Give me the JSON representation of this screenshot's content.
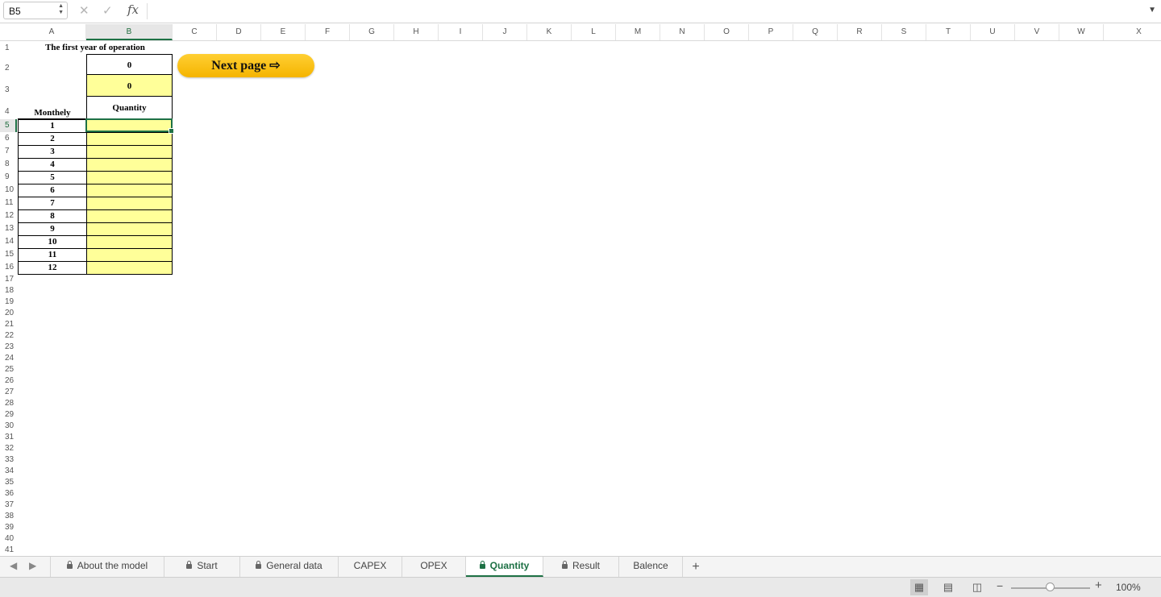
{
  "formula_bar": {
    "cell_ref": "B5",
    "cancel_glyph": "✕",
    "enter_glyph": "✓",
    "fx_label": "fx",
    "formula": ""
  },
  "columns": [
    "A",
    "B",
    "C",
    "D",
    "E",
    "F",
    "G",
    "H",
    "I",
    "J",
    "K",
    "L",
    "M",
    "N",
    "O",
    "P",
    "Q",
    "R",
    "S",
    "T",
    "U",
    "V",
    "W",
    "X"
  ],
  "selected_column": "B",
  "rows": [
    "1",
    "2",
    "3",
    "4",
    "5",
    "6",
    "7",
    "8",
    "9",
    "10",
    "11",
    "12",
    "13",
    "14",
    "15",
    "16",
    "17",
    "18",
    "19",
    "20",
    "21",
    "22",
    "23",
    "24",
    "25",
    "26",
    "27",
    "28",
    "29",
    "30",
    "31",
    "32",
    "33",
    "34",
    "35",
    "36",
    "37",
    "38",
    "39",
    "40",
    "41"
  ],
  "selected_row": "5",
  "sheet": {
    "title": "The first year of operation",
    "b2_value": "0",
    "b3_value": "0",
    "month_header": "Monthely",
    "quantity_header": "Quantity",
    "months": [
      "1",
      "2",
      "3",
      "4",
      "5",
      "6",
      "7",
      "8",
      "9",
      "10",
      "11",
      "12"
    ],
    "quantities": [
      "",
      "",
      "",
      "",
      "",
      "",
      "",
      "",
      "",
      "",
      "",
      ""
    ],
    "input_fill": "#ffff99"
  },
  "next_button": {
    "label": "Next page ⇨",
    "color": "#ffc000"
  },
  "tabs": [
    {
      "label": "About the model",
      "locked": true,
      "active": false
    },
    {
      "label": "Start",
      "locked": true,
      "active": false
    },
    {
      "label": "General data",
      "locked": true,
      "active": false
    },
    {
      "label": "CAPEX",
      "locked": false,
      "active": false
    },
    {
      "label": "OPEX",
      "locked": false,
      "active": false
    },
    {
      "label": "Quantity",
      "locked": true,
      "active": true
    },
    {
      "label": "Result",
      "locked": true,
      "active": false
    },
    {
      "label": "Balence",
      "locked": false,
      "active": false
    }
  ],
  "add_sheet_label": "+",
  "status": {
    "zoom_label": "100%",
    "zoom_level": 100,
    "view_icons": [
      "normal-view-icon",
      "page-layout-view-icon",
      "page-break-view-icon"
    ],
    "accent": "#1e7145"
  }
}
